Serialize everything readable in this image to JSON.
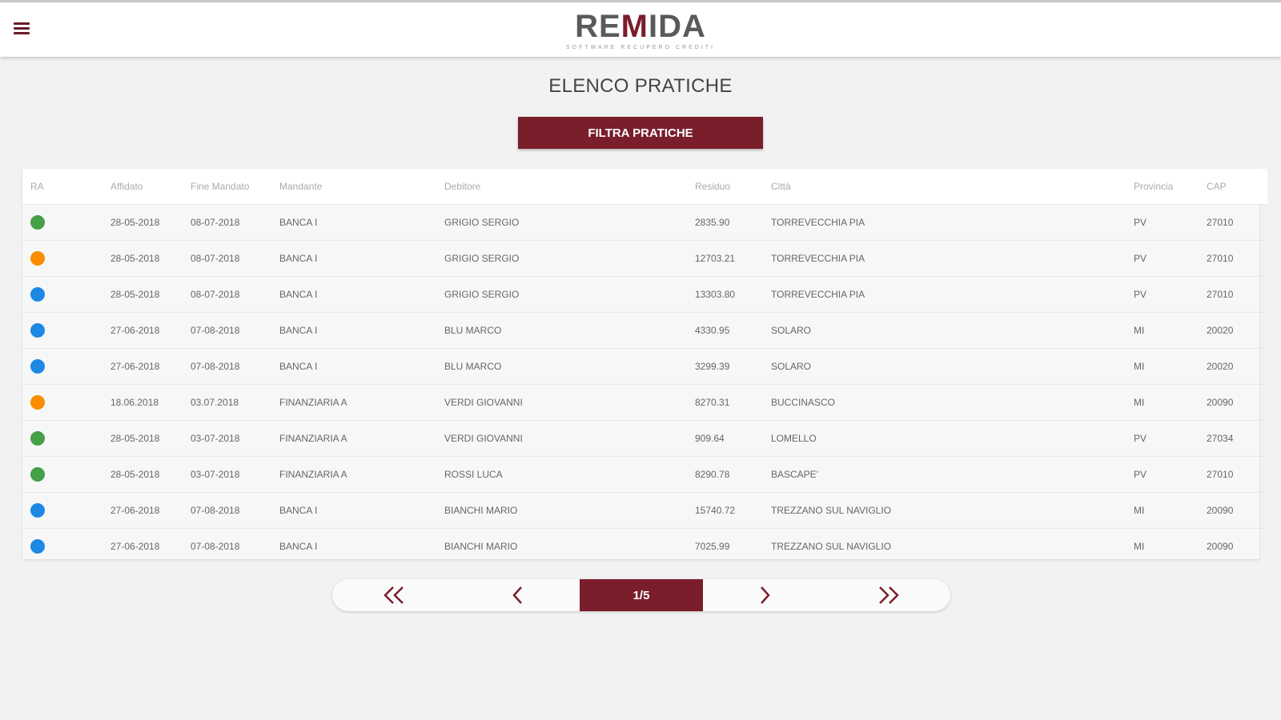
{
  "header": {
    "menu_icon": "hamburger-menu-icon",
    "logo_text_left": "RE",
    "logo_text_m": "M",
    "logo_text_right": "IDA",
    "logo_tagline": "SOFTWARE RECUPERO CREDITI"
  },
  "page": {
    "title": "ELENCO PRATICHE",
    "filter_button_label": "FILTRA PRATICHE"
  },
  "colors": {
    "brand": "#7a1e2c",
    "status_green": "#43a047",
    "status_orange": "#fb8c00",
    "status_blue": "#1e88e5"
  },
  "table": {
    "columns": [
      "RA",
      "Affidato",
      "Fine Mandato",
      "Mandante",
      "Debitore",
      "Residuo",
      "Città",
      "Provincia",
      "CAP"
    ],
    "rows": [
      {
        "status": "green",
        "affidato": "28-05-2018",
        "fine_mandato": "08-07-2018",
        "mandante": "BANCA I",
        "debitore": "GRIGIO SERGIO",
        "residuo": "2835.90",
        "citta": "TORREVECCHIA PIA",
        "provincia": "PV",
        "cap": "27010"
      },
      {
        "status": "orange",
        "affidato": "28-05-2018",
        "fine_mandato": "08-07-2018",
        "mandante": "BANCA I",
        "debitore": "GRIGIO SERGIO",
        "residuo": "12703.21",
        "citta": "TORREVECCHIA PIA",
        "provincia": "PV",
        "cap": "27010"
      },
      {
        "status": "blue",
        "affidato": "28-05-2018",
        "fine_mandato": "08-07-2018",
        "mandante": "BANCA I",
        "debitore": "GRIGIO SERGIO",
        "residuo": "13303.80",
        "citta": "TORREVECCHIA PIA",
        "provincia": "PV",
        "cap": "27010"
      },
      {
        "status": "blue",
        "affidato": "27-06-2018",
        "fine_mandato": "07-08-2018",
        "mandante": "BANCA I",
        "debitore": "BLU MARCO",
        "residuo": "4330.95",
        "citta": "SOLARO",
        "provincia": "MI",
        "cap": "20020"
      },
      {
        "status": "blue",
        "affidato": "27-06-2018",
        "fine_mandato": "07-08-2018",
        "mandante": "BANCA I",
        "debitore": "BLU MARCO",
        "residuo": "3299.39",
        "citta": "SOLARO",
        "provincia": "MI",
        "cap": "20020"
      },
      {
        "status": "orange",
        "affidato": "18.06.2018",
        "fine_mandato": "03.07.2018",
        "mandante": "FINANZIARIA A",
        "debitore": "VERDI GIOVANNI",
        "residuo": "8270.31",
        "citta": "BUCCINASCO",
        "provincia": "MI",
        "cap": "20090"
      },
      {
        "status": "green",
        "affidato": "28-05-2018",
        "fine_mandato": "03-07-2018",
        "mandante": "FINANZIARIA A",
        "debitore": "VERDI GIOVANNI",
        "residuo": "909.64",
        "citta": "LOMELLO",
        "provincia": "PV",
        "cap": "27034"
      },
      {
        "status": "green",
        "affidato": "28-05-2018",
        "fine_mandato": "03-07-2018",
        "mandante": "FINANZIARIA A",
        "debitore": "ROSSI LUCA",
        "residuo": "8290.78",
        "citta": "BASCAPE'",
        "provincia": "PV",
        "cap": "27010"
      },
      {
        "status": "blue",
        "affidato": "27-06-2018",
        "fine_mandato": "07-08-2018",
        "mandante": "BANCA I",
        "debitore": "BIANCHI MARIO",
        "residuo": "15740.72",
        "citta": "TREZZANO SUL NAVIGLIO",
        "provincia": "MI",
        "cap": "20090"
      },
      {
        "status": "blue",
        "affidato": "27-06-2018",
        "fine_mandato": "07-08-2018",
        "mandante": "BANCA I",
        "debitore": "BIANCHI MARIO",
        "residuo": "7025.99",
        "citta": "TREZZANO SUL NAVIGLIO",
        "provincia": "MI",
        "cap": "20090"
      }
    ]
  },
  "pagination": {
    "first_icon": "double-chevron-left-icon",
    "prev_icon": "chevron-left-icon",
    "current_label": "1/5",
    "next_icon": "chevron-right-icon",
    "last_icon": "double-chevron-right-icon"
  }
}
